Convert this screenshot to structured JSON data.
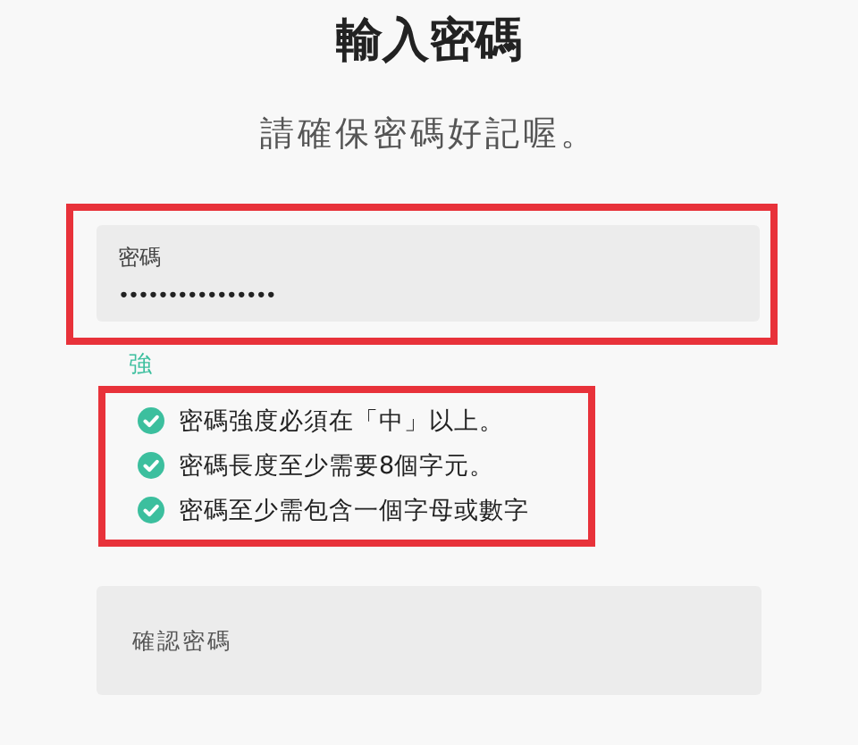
{
  "title": "輸入密碼",
  "subtitle": "請確保密碼好記喔。",
  "password_field": {
    "label": "密碼",
    "value": "••••••••••••••••",
    "highlighted": true
  },
  "strength": "強",
  "rules": {
    "highlighted": true,
    "items": [
      {
        "text": "密碼強度必須在「中」以上。",
        "checked": true
      },
      {
        "text": "密碼長度至少需要8個字元。",
        "checked": true
      },
      {
        "text": "密碼至少需包含一個字母或數字",
        "checked": true
      }
    ]
  },
  "confirm_field": {
    "placeholder": "確認密碼"
  }
}
